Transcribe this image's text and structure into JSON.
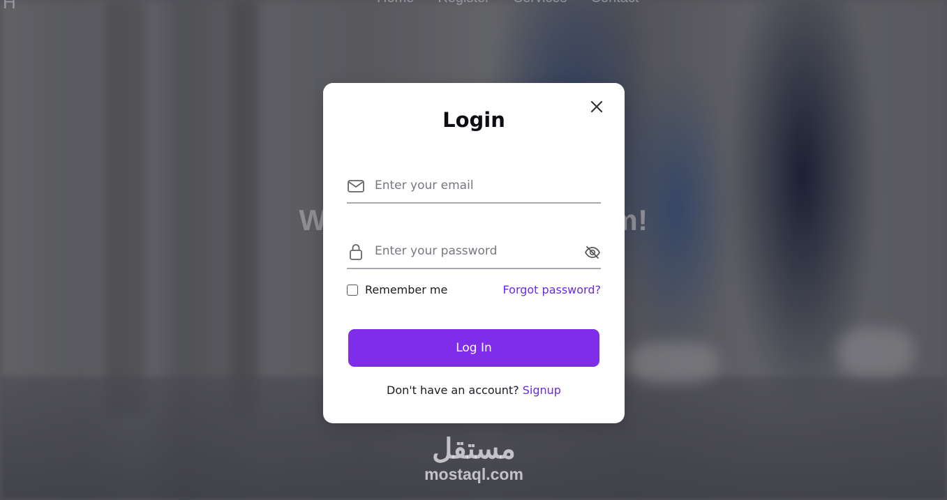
{
  "background": {
    "nav_items": [
      "Home",
      "Register",
      "Services",
      "Contact"
    ],
    "logo_text": "H",
    "hero_title": "Welcome to our System!",
    "watermark": {
      "logo_text": "مستقل",
      "url_text": "mostaql.com"
    }
  },
  "modal": {
    "title": "Login",
    "close_icon": "close-icon",
    "email": {
      "icon": "mail-icon",
      "placeholder": "Enter your email",
      "value": ""
    },
    "password": {
      "icon": "lock-icon",
      "placeholder": "Enter your password",
      "value": "",
      "toggle_icon": "eye-off-icon"
    },
    "remember_label": "Remember me",
    "remember_checked": false,
    "forgot_label": "Forgot password?",
    "login_button_label": "Log In",
    "signup_prompt": "Don't have an account?",
    "signup_link": "Signup"
  },
  "colors": {
    "accent": "#7f2de8",
    "link": "#6a2ae0",
    "title": "#0d0d14",
    "modal_bg": "#ffffff"
  }
}
